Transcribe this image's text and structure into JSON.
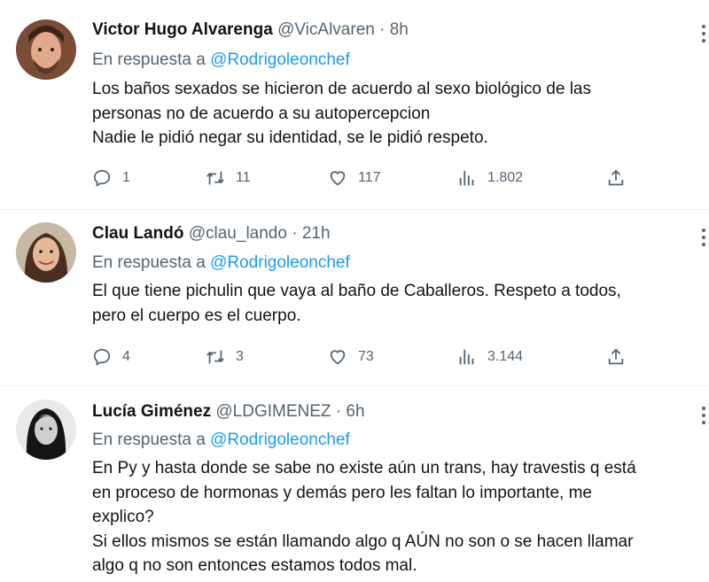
{
  "tweets": [
    {
      "name": "Victor Hugo Alvarenga",
      "handle": "@VicAlvaren",
      "sep": "·",
      "time": "8h",
      "reply_prefix": "En respuesta a",
      "reply_to": "@Rodrigoleonchef",
      "lines": [
        "Los baños sexados se hicieron de acuerdo al sexo biológico de las",
        "personas no de acuerdo a su autopercepcion",
        "Nadie le pidió negar su identidad, se le pidió respeto."
      ],
      "replies": "1",
      "retweets": "11",
      "likes": "117",
      "views": "1.802"
    },
    {
      "name": "Clau Landó",
      "handle": "@clau_lando",
      "sep": "·",
      "time": "21h",
      "reply_prefix": "En respuesta a",
      "reply_to": "@Rodrigoleonchef",
      "lines": [
        "El que tiene pichulin que vaya al baño de Caballeros. Respeto a todos,",
        "pero el cuerpo es el cuerpo."
      ],
      "replies": "4",
      "retweets": "3",
      "likes": "73",
      "views": "3.144"
    },
    {
      "name": "Lucía Giménez",
      "handle": "@LDGIMENEZ",
      "sep": "·",
      "time": "6h",
      "reply_prefix": "En respuesta a",
      "reply_to": "@Rodrigoleonchef",
      "lines": [
        "En Py y hasta donde se sabe no existe aún un trans, hay travestis q está",
        "en proceso de hormonas y demás pero les faltan lo importante, me",
        "explico?",
        "Si ellos mismos se están llamando algo q AÚN no son o se hacen llamar",
        "algo q no son entonces estamos todos mal."
      ]
    }
  ],
  "icons": {
    "reply": "reply-icon",
    "retweet": "retweet-icon",
    "like": "heart-icon",
    "views": "views-icon",
    "share": "share-icon",
    "more": "more-icon"
  },
  "colors": {
    "text": "#0f1419",
    "muted": "#536471",
    "link": "#1d9bf0",
    "divider": "#eff3f4"
  }
}
